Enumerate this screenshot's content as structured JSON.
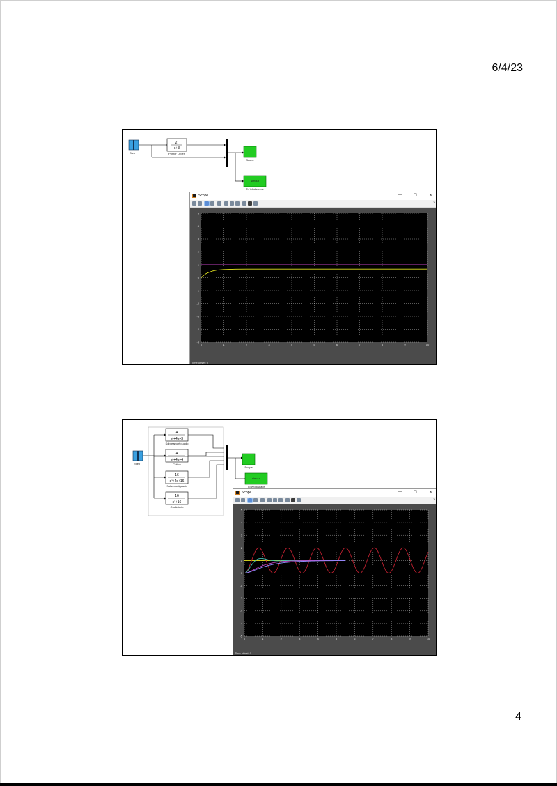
{
  "header": {
    "date": "6/4/23"
  },
  "footer": {
    "page_number": "4"
  },
  "slide1": {
    "diagram": {
      "step_label": "Step",
      "tf_num": "2",
      "tf_den": "s+3",
      "tf_label": "Primer Orden",
      "scope_label": "Scope",
      "workspace_text": "simout",
      "workspace_label": "To Workspace"
    },
    "scope": {
      "title": "Scope",
      "minimize": "—",
      "maximize": "☐",
      "close": "✕",
      "more": "»",
      "status": "Time offset:  0"
    }
  },
  "slide2": {
    "diagram": {
      "step_label": "Step",
      "tf1_num": "4",
      "tf1_den": "s²+4s+3",
      "tf1_label": "Sobreamortiguado",
      "tf2_num": "4",
      "tf2_den": "s²+4s+4",
      "tf2_label": "Crítico",
      "tf3_num": "16",
      "tf3_den": "s²+4s+16",
      "tf3_label": "Subamortiguado",
      "tf4_num": "16",
      "tf4_den": "s²+16",
      "tf4_label": "Oscilatorio",
      "scope_label": "Scope",
      "workspace_text": "simout",
      "workspace_label": "To Workspace"
    },
    "scope": {
      "title": "Scope",
      "minimize": "—",
      "maximize": "☐",
      "close": "✕",
      "more": "»",
      "status": "Time offset:  0"
    }
  },
  "colors": {
    "scope_background": "#000000",
    "grid": "#ffffff",
    "trace_yellow": "#e8e820",
    "trace_magenta": "#c040c0",
    "trace_red": "#c02030",
    "trace_cyan": "#40c0b0",
    "block_green": "#22cc22",
    "block_blue": "#3aa0e0"
  },
  "chart_data": [
    {
      "type": "line",
      "title": "",
      "xlim": [
        0,
        10
      ],
      "ylim": [
        -5,
        5
      ],
      "xticks": [
        "0",
        "1",
        "2",
        "3",
        "4",
        "5",
        "6",
        "7",
        "8",
        "9",
        "10"
      ],
      "yticks": [
        "5",
        "4",
        "3",
        "2",
        "1",
        "0",
        "-1",
        "-2",
        "-3",
        "-4",
        "-5"
      ],
      "grid": true,
      "series": [
        {
          "color": "#c040c0",
          "x": [
            0,
            10
          ],
          "y": [
            1,
            1
          ]
        },
        {
          "color": "#e8e820",
          "x": [
            0,
            0.1,
            0.2,
            0.3,
            0.5,
            0.7,
            1,
            1.5,
            2,
            3,
            5,
            10
          ],
          "y": [
            0,
            0.17,
            0.3,
            0.39,
            0.52,
            0.59,
            0.63,
            0.66,
            0.667,
            0.667,
            0.667,
            0.667
          ]
        }
      ]
    },
    {
      "type": "line",
      "title": "",
      "xlim": [
        0,
        10
      ],
      "ylim": [
        -5,
        5
      ],
      "xticks": [
        "0",
        "1",
        "2",
        "3",
        "4",
        "5",
        "6",
        "7",
        "8",
        "9",
        "10"
      ],
      "yticks": [
        "5",
        "4",
        "3",
        "2",
        "1",
        "0",
        "-1",
        "-2",
        "-3",
        "-4",
        "-5"
      ],
      "grid": true,
      "series": [
        {
          "color": "#e8e820",
          "x": [
            0,
            5.5
          ],
          "y": [
            1,
            1
          ]
        },
        {
          "color": "#c02030",
          "expr": "oscillatory",
          "x": [
            0,
            10
          ],
          "y": [
            0,
            2
          ]
        },
        {
          "color": "#40c0b0",
          "expr": "underdamped",
          "x": [
            0,
            5.5
          ],
          "y": [
            0,
            1.2
          ]
        },
        {
          "color": "#c040c0",
          "expr": "critical",
          "x": [
            0,
            5.5
          ],
          "y": [
            0,
            1
          ]
        },
        {
          "color": "#9090ff",
          "expr": "overdamped",
          "x": [
            0,
            5.5
          ],
          "y": [
            0,
            1
          ]
        }
      ]
    }
  ]
}
